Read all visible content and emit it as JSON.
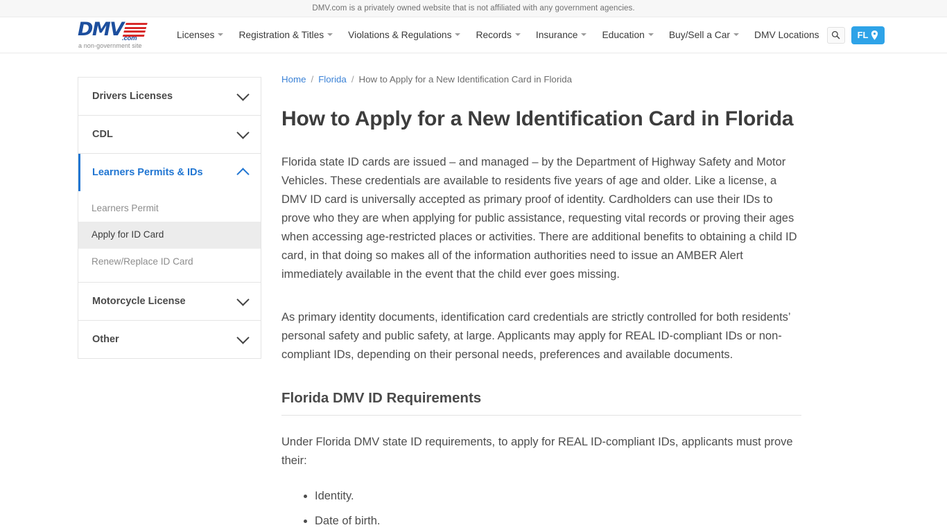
{
  "topbar": {
    "disclaimer": "DMV.com is a privately owned website that is not affiliated with any government agencies."
  },
  "header": {
    "logo": {
      "word": "DMV",
      "suffix": ".com",
      "tagline": "a non-government site"
    },
    "nav": [
      {
        "label": "Licenses",
        "has_caret": true
      },
      {
        "label": "Registration & Titles",
        "has_caret": true
      },
      {
        "label": "Violations & Regulations",
        "has_caret": true
      },
      {
        "label": "Records",
        "has_caret": true
      },
      {
        "label": "Insurance",
        "has_caret": true
      },
      {
        "label": "Education",
        "has_caret": true
      },
      {
        "label": "Buy/Sell a Car",
        "has_caret": true
      },
      {
        "label": "DMV Locations",
        "has_caret": false
      }
    ],
    "search_icon": "search-icon",
    "state_button": {
      "label": "FL",
      "icon": "location-pin-icon",
      "color": "#2ea3e8"
    }
  },
  "sidebar": {
    "sections": [
      {
        "label": "Drivers Licenses",
        "expanded": false,
        "active": false,
        "items": []
      },
      {
        "label": "CDL",
        "expanded": false,
        "active": false,
        "items": []
      },
      {
        "label": "Learners Permits & IDs",
        "expanded": true,
        "active": true,
        "items": [
          {
            "label": "Learners Permit",
            "selected": false
          },
          {
            "label": "Apply for ID Card",
            "selected": true
          },
          {
            "label": "Renew/Replace ID Card",
            "selected": false
          }
        ]
      },
      {
        "label": "Motorcycle License",
        "expanded": false,
        "active": false,
        "items": []
      },
      {
        "label": "Other",
        "expanded": false,
        "active": false,
        "items": []
      }
    ],
    "accent_color": "#2176d2"
  },
  "main": {
    "breadcrumb": {
      "home": "Home",
      "state": "Florida",
      "current": "How to Apply for a New Identification Card in Florida",
      "separator": "/"
    },
    "title": "How to Apply for a New Identification Card in Florida",
    "paragraph1": "Florida state ID cards are issued – and managed – by the Department of Highway Safety and Motor Vehicles. These credentials are available to residents five years of age and older. Like a license, a DMV ID card is universally accepted as primary proof of identity. Cardholders can use their IDs to prove who they are when applying for public assistance, requesting vital records or proving their ages when accessing age-restricted places or activities. There are additional benefits to obtaining a child ID card, in that doing so makes all of the information authorities need to issue an AMBER Alert immediately available in the event that the child ever goes missing.",
    "paragraph2": "As primary identity documents, identification card credentials are strictly controlled for both residents’ personal safety and public safety, at large. Applicants may apply for REAL ID-compliant IDs or non-compliant IDs, depending on their personal needs, preferences and available documents.",
    "section_heading": "Florida DMV ID Requirements",
    "paragraph3": "Under Florida DMV state ID requirements, to apply for REAL ID-compliant IDs, applicants must prove their:",
    "bullets": [
      "Identity.",
      "Date of birth."
    ]
  }
}
